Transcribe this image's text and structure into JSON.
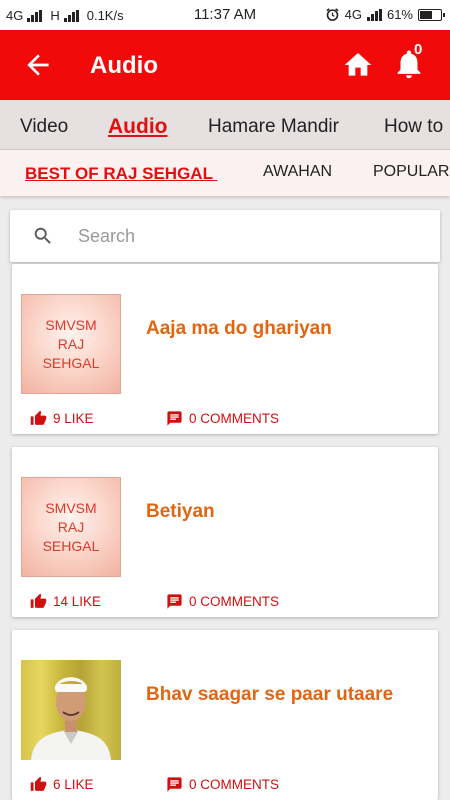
{
  "status_bar": {
    "network1": "4G",
    "network2": "H",
    "speed": "0.1K/s",
    "time": "11:37 AM",
    "network3": "4G",
    "battery": "61%",
    "battery_level": 0.61
  },
  "app_bar": {
    "title": "Audio",
    "notification_count": "0"
  },
  "tabs": [
    {
      "label": "Video"
    },
    {
      "label": "Audio"
    },
    {
      "label": "Hamare Mandir"
    },
    {
      "label": "How to"
    }
  ],
  "subtabs": [
    {
      "label": "BEST OF RAJ SEHGAL "
    },
    {
      "label": "AWAHAN"
    },
    {
      "label": "POPULAR"
    }
  ],
  "search": {
    "placeholder": "Search",
    "value": ""
  },
  "items": [
    {
      "thumb_text": [
        "SMVSM",
        "RAJ",
        "SEHGAL"
      ],
      "title": "Aaja ma do ghariyan",
      "likes": "9 LIKE",
      "comments": "0 COMMENTS"
    },
    {
      "thumb_text": [
        "SMVSM",
        "RAJ",
        "SEHGAL"
      ],
      "title": "Betiyan",
      "likes": "14 LIKE",
      "comments": "0 COMMENTS"
    },
    {
      "thumb_text": [],
      "title": "Bhav saagar se paar utaare",
      "likes": "6 LIKE",
      "comments": "0 COMMENTS"
    }
  ],
  "colors": {
    "primary": "#f20a0a",
    "accent": "#e11010",
    "title": "#e26512"
  },
  "icons": [
    "back-arrow-icon",
    "home-icon",
    "bell-icon",
    "search-icon",
    "thumbs-up-icon",
    "comment-icon",
    "alarm-icon",
    "battery-icon"
  ]
}
